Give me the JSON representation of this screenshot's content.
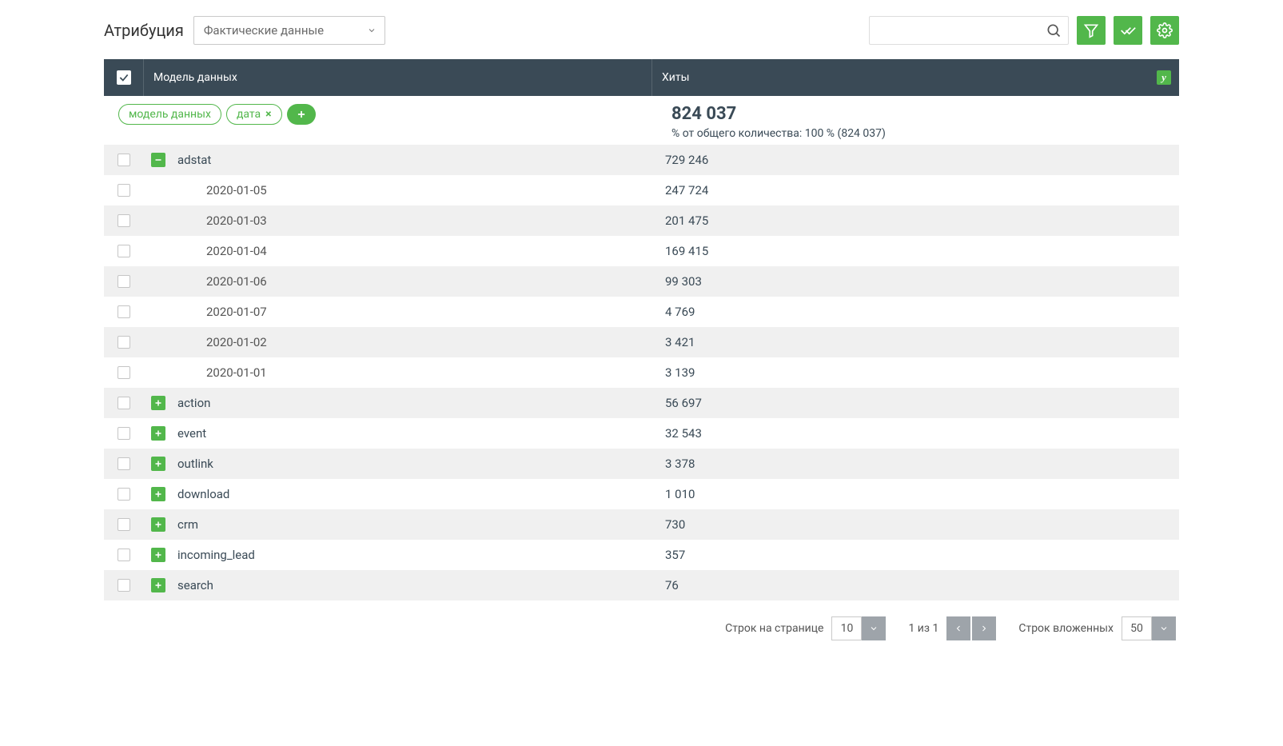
{
  "header": {
    "title": "Атрибуция",
    "data_select": "Фактические данные",
    "search_placeholder": ""
  },
  "columns": {
    "model": "Модель данных",
    "hits": "Хиты"
  },
  "chips": [
    {
      "label": "модель данных",
      "removable": false
    },
    {
      "label": "дата",
      "removable": true
    }
  ],
  "summary": {
    "total": "824 037",
    "subtitle": "% от общего количества: 100 % (824 037)"
  },
  "groups": [
    {
      "name": "adstat",
      "hits": "729 246",
      "expanded": true,
      "children": [
        {
          "date": "2020-01-05",
          "hits": "247 724"
        },
        {
          "date": "2020-01-03",
          "hits": "201 475"
        },
        {
          "date": "2020-01-04",
          "hits": "169 415"
        },
        {
          "date": "2020-01-06",
          "hits": "99 303"
        },
        {
          "date": "2020-01-07",
          "hits": "4 769"
        },
        {
          "date": "2020-01-02",
          "hits": "3 421"
        },
        {
          "date": "2020-01-01",
          "hits": "3 139"
        }
      ]
    },
    {
      "name": "action",
      "hits": "56 697",
      "expanded": false
    },
    {
      "name": "event",
      "hits": "32 543",
      "expanded": false
    },
    {
      "name": "outlink",
      "hits": "3 378",
      "expanded": false
    },
    {
      "name": "download",
      "hits": "1 010",
      "expanded": false
    },
    {
      "name": "crm",
      "hits": "730",
      "expanded": false
    },
    {
      "name": "incoming_lead",
      "hits": "357",
      "expanded": false
    },
    {
      "name": "search",
      "hits": "76",
      "expanded": false
    }
  ],
  "footer": {
    "rows_per_page_label": "Строк на странице",
    "rows_per_page_value": "10",
    "page_info": "1 из 1",
    "nested_rows_label": "Строк вложенных",
    "nested_rows_value": "50"
  }
}
